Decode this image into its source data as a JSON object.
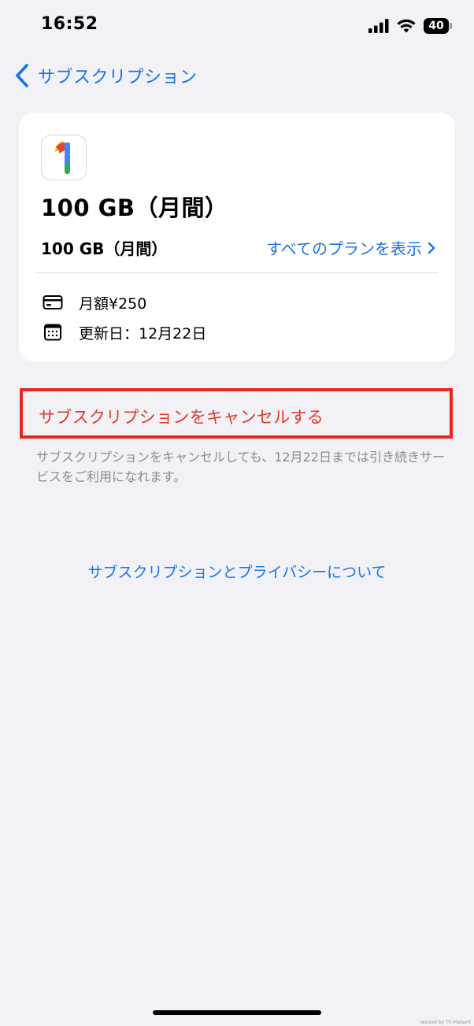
{
  "status_bar": {
    "time": "16:52",
    "battery": "40"
  },
  "nav": {
    "back_label": "サブスクリプション"
  },
  "subscription": {
    "title": "100 GB（月間）",
    "plan_name": "100 GB（月間）",
    "view_all_label": "すべてのプランを表示",
    "price": "月額¥250",
    "renewal": "更新日：12月22日"
  },
  "cancel": {
    "label": "サブスクリプションをキャンセルする",
    "note": "サブスクリプションをキャンセルしても、12月22日までは引き続きサービスをご利用になれます。"
  },
  "privacy_link": "サブスクリプションとプライバシーについて",
  "watermark": "resized by Th-MakerX",
  "colors": {
    "link_blue": "#1a73e8",
    "cancel_red": "#e2392b",
    "highlight_border": "#e8261a",
    "background": "#f1f1f6"
  },
  "icons": {
    "back": "chevron-left-icon",
    "view_all": "chevron-right-icon",
    "price": "credit-card-icon",
    "renewal": "calendar-icon",
    "app": "google-one-icon"
  }
}
